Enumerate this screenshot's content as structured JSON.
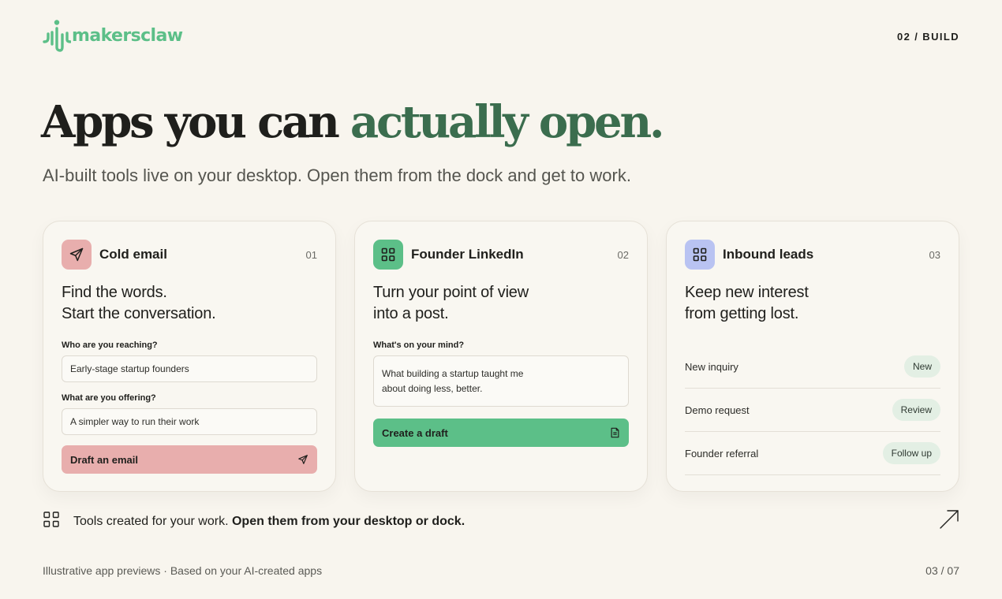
{
  "brand": {
    "name": "makersclaw",
    "color": "#5cbf88"
  },
  "header": {
    "section": "02 / BUILD"
  },
  "hero": {
    "title_part1": "Apps you can ",
    "title_accent": "actually open.",
    "accent_color": "#3b6d4e",
    "subtitle": "AI-built tools live on your desktop. Open them from the dock and get to work."
  },
  "cards": [
    {
      "title": "Cold email",
      "number": "01",
      "icon": "paper-plane-icon",
      "icon_bg": "#e8aead",
      "desc_line1": "Find the words.",
      "desc_line2": "Start the conversation.",
      "field1_label": "Who are you reaching?",
      "field1_value": "Early-stage startup founders",
      "field2_label": "What are you offering?",
      "field2_value": "A simpler way to run their work",
      "action_label": "Draft an email",
      "action_icon": "send-icon"
    },
    {
      "title": "Founder LinkedIn",
      "number": "02",
      "icon": "grid-icon",
      "icon_bg": "#5cbf88",
      "desc_line1": "Turn your point of view",
      "desc_line2": "into a post.",
      "field1_label": "What's on your mind?",
      "field1_value": "What building a startup taught me\nabout doing less, better.",
      "action_label": "Create a draft",
      "action_icon": "document-icon"
    },
    {
      "title": "Inbound leads",
      "number": "03",
      "icon": "grid-icon",
      "icon_bg": "#b9c3f2",
      "desc_line1": "Keep new interest",
      "desc_line2": "from getting lost.",
      "leads": [
        {
          "name": "New inquiry",
          "status": "New"
        },
        {
          "name": "Demo request",
          "status": "Review"
        },
        {
          "name": "Founder referral",
          "status": "Follow up"
        }
      ]
    }
  ],
  "footer": {
    "tools_text": "Tools created for your work.",
    "tools_bold": "Open them from your desktop or dock.",
    "note": "Illustrative app previews · Based on your AI-created apps",
    "page": "03 / 07"
  }
}
